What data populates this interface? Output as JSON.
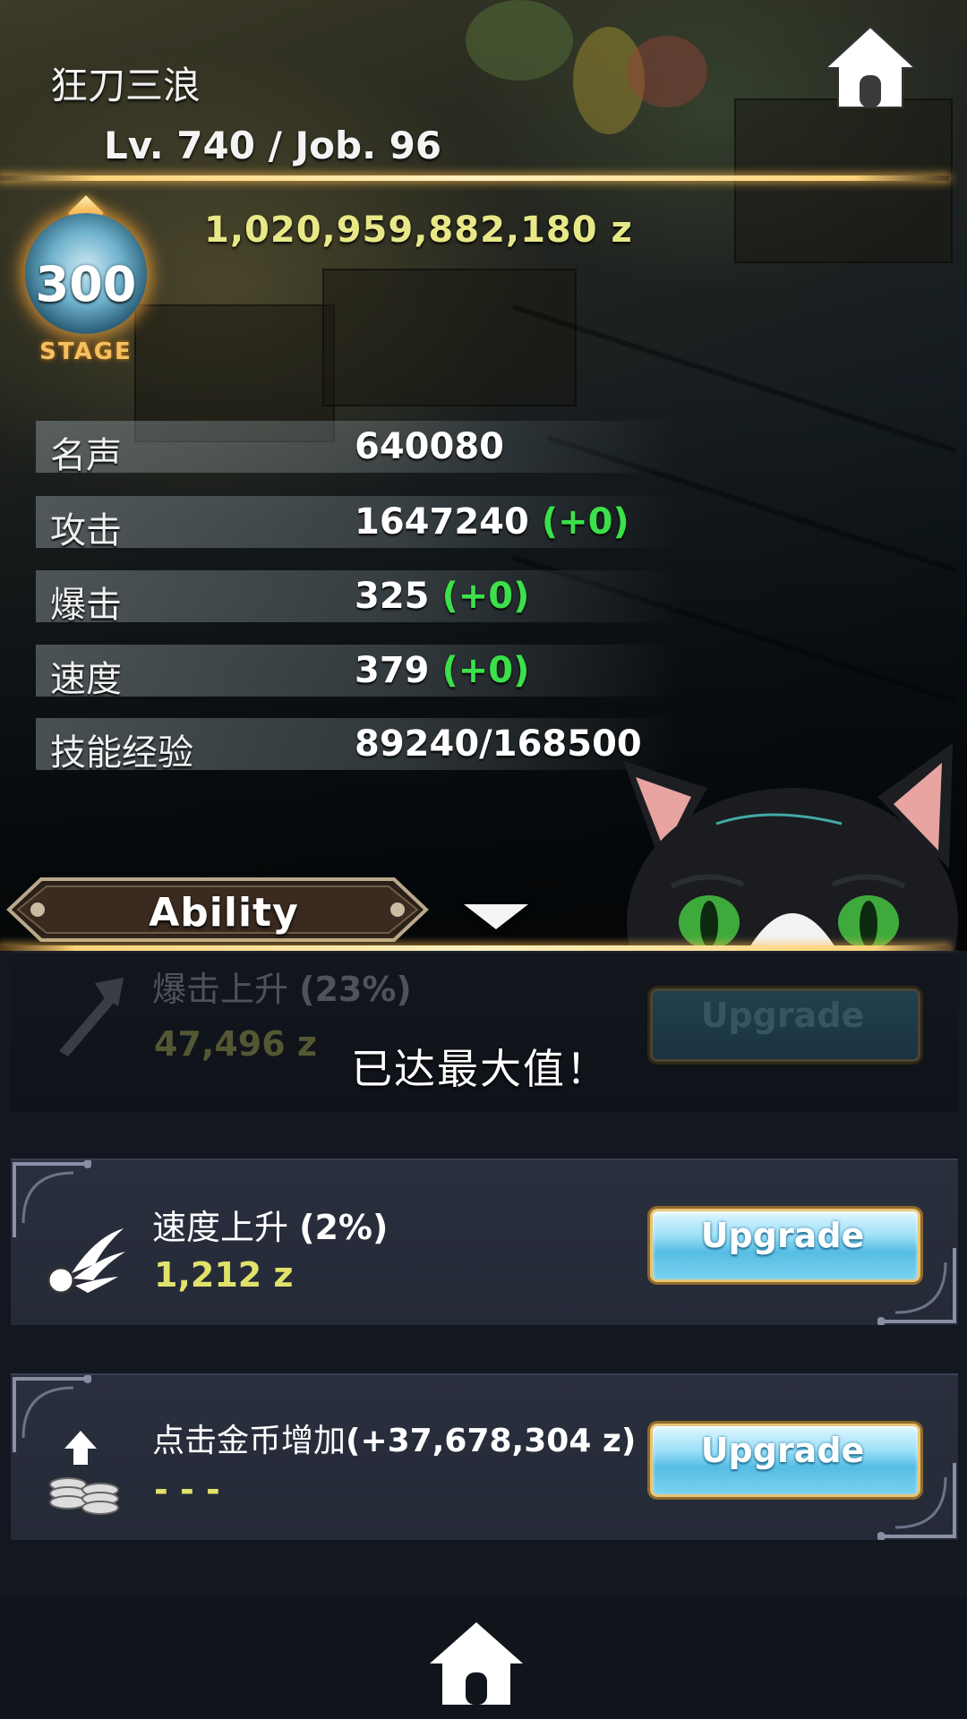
{
  "header": {
    "player_name": "狂刀三浪",
    "level_job": "Lv. 740 / Job. 96",
    "gold": "1,020,959,882,180 z",
    "stage_number": "300",
    "stage_label": "STAGE"
  },
  "stats": [
    {
      "label": "名声",
      "value": "640080",
      "bonus": ""
    },
    {
      "label": "攻击",
      "value": "1647240",
      "bonus": "(+0)"
    },
    {
      "label": "爆击",
      "value": "325",
      "bonus": "(+0)"
    },
    {
      "label": "速度",
      "value": "379",
      "bonus": "(+0)"
    },
    {
      "label": "技能经验",
      "value": "89240/168500",
      "bonus": ""
    }
  ],
  "ability_tab": {
    "label": "Ability"
  },
  "abilities": [
    {
      "title": "爆击上升",
      "percent": "(23%)",
      "cost": "47,496 z",
      "button": "Upgrade",
      "icon": "crit-sword-icon",
      "maxed": true
    },
    {
      "title": "速度上升",
      "percent": "(2%)",
      "cost": "1,212 z",
      "button": "Upgrade",
      "icon": "wing-speed-icon",
      "maxed": false
    },
    {
      "title": "点击金币增加",
      "percent": "(+37,678,304 z)",
      "cost": "- - -",
      "button": "Upgrade",
      "icon": "coin-stack-up-icon",
      "maxed": false
    }
  ],
  "max_message": "已达最大值！",
  "colors": {
    "gold_text": "#e8e888",
    "bonus_green": "#3be04a",
    "cost_yellow": "#e1e26a",
    "accent_gold_line": "#ffd37a",
    "button_blue": "#56bde4"
  },
  "icons": {
    "home_top": "home-icon",
    "home_bottom": "home-icon",
    "dropdown": "triangle-down-icon"
  }
}
